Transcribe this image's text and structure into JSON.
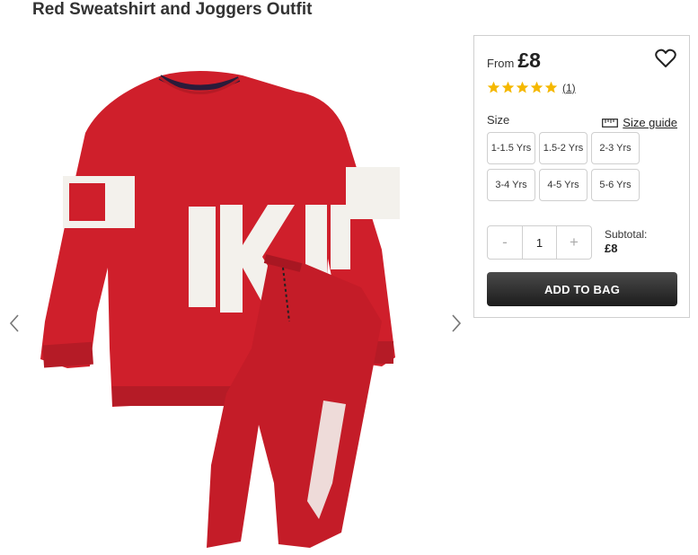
{
  "product": {
    "title": "Red Sweatshirt and Joggers Outfit",
    "image_alt": "Red sweatshirt printed COOLEST KID with matching red joggers"
  },
  "gallery": {
    "prev_icon": "chevron-left-icon",
    "next_icon": "chevron-right-icon"
  },
  "panel": {
    "from_label": "From",
    "price": "£8",
    "wishlist_icon": "heart-icon",
    "rating": {
      "stars": 5,
      "review_count": "(1)",
      "star_color": "#f5b800"
    },
    "size_label": "Size",
    "size_guide_label": "Size guide",
    "sizes": [
      "1-1.5 Yrs",
      "1.5-2 Yrs",
      "2-3 Yrs",
      "3-4 Yrs",
      "4-5 Yrs",
      "5-6 Yrs"
    ],
    "quantity": {
      "minus": "-",
      "value": "1",
      "plus": "+"
    },
    "subtotal_label": "Subtotal:",
    "subtotal_value": "£8",
    "add_to_bag_label": "ADD TO BAG"
  },
  "colors": {
    "garment_red": "#cf1f2b",
    "button_dark": "#2a2a2a"
  }
}
